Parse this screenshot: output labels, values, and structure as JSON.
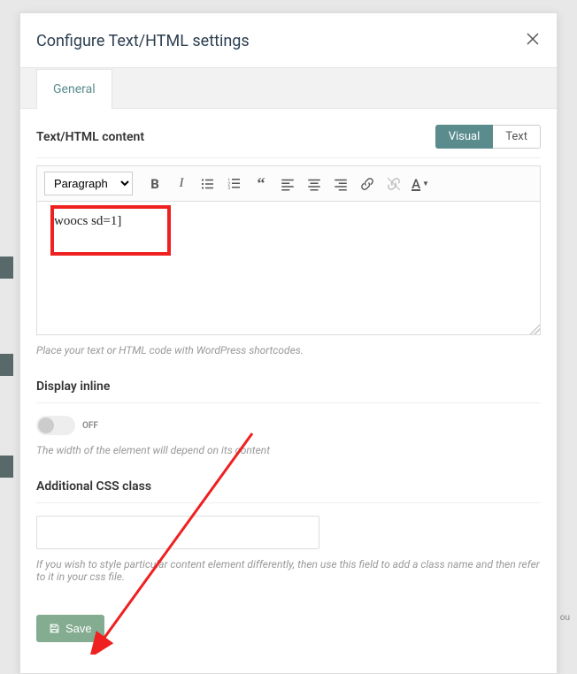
{
  "modal": {
    "title": "Configure Text/HTML settings",
    "tabs": [
      {
        "label": "General",
        "active": true
      }
    ],
    "content_section": {
      "label": "Text/HTML content",
      "mode_visual": "Visual",
      "mode_text": "Text",
      "format_select": "Paragraph",
      "editor_value": "[woocs sd=1]",
      "help": "Place your text or HTML code with WordPress shortcodes."
    },
    "inline_section": {
      "label": "Display inline",
      "toggle_state": "OFF",
      "help": "The width of the element will depend on its content"
    },
    "css_section": {
      "label": "Additional CSS class",
      "value": "",
      "help": "If you wish to style particular content element differently, then use this field to add a class name and then refer to it in your css file."
    },
    "save_label": "Save"
  },
  "bg_text": "re ou"
}
